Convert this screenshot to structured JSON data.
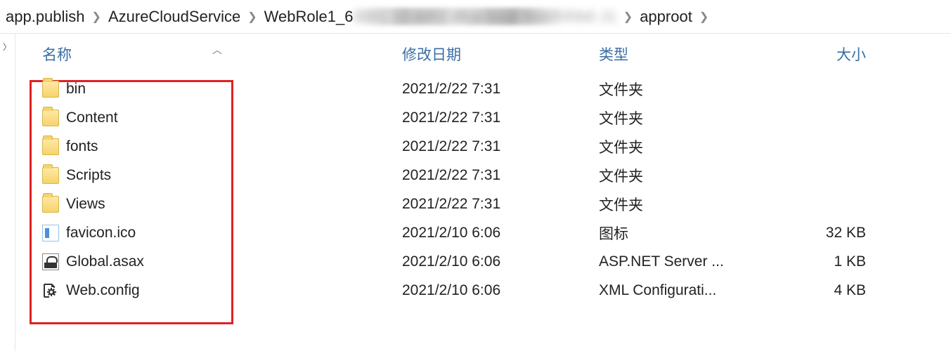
{
  "breadcrumb": {
    "items": [
      {
        "label": "app.publish"
      },
      {
        "label": "AzureCloudService"
      },
      {
        "label_prefix": "WebRole1_6",
        "label_obscured": "0001 10 dd02 4fca bccd 8bb05f0b0 J1"
      },
      {
        "label": "approot"
      }
    ]
  },
  "columns": {
    "name": "名称",
    "date": "修改日期",
    "type": "类型",
    "size": "大小"
  },
  "rows": [
    {
      "icon": "folder",
      "name": "bin",
      "date": "2021/2/22 7:31",
      "type": "文件夹",
      "size": ""
    },
    {
      "icon": "folder",
      "name": "Content",
      "date": "2021/2/22 7:31",
      "type": "文件夹",
      "size": ""
    },
    {
      "icon": "folder",
      "name": "fonts",
      "date": "2021/2/22 7:31",
      "type": "文件夹",
      "size": ""
    },
    {
      "icon": "folder",
      "name": "Scripts",
      "date": "2021/2/22 7:31",
      "type": "文件夹",
      "size": ""
    },
    {
      "icon": "folder",
      "name": "Views",
      "date": "2021/2/22 7:31",
      "type": "文件夹",
      "size": ""
    },
    {
      "icon": "ico",
      "name": "favicon.ico",
      "date": "2021/2/10 6:06",
      "type": "图标",
      "size": "32 KB"
    },
    {
      "icon": "asax",
      "name": "Global.asax",
      "date": "2021/2/10 6:06",
      "type": "ASP.NET Server ...",
      "size": "1 KB"
    },
    {
      "icon": "config",
      "name": "Web.config",
      "date": "2021/2/10 6:06",
      "type": "XML Configurati...",
      "size": "4 KB"
    }
  ]
}
